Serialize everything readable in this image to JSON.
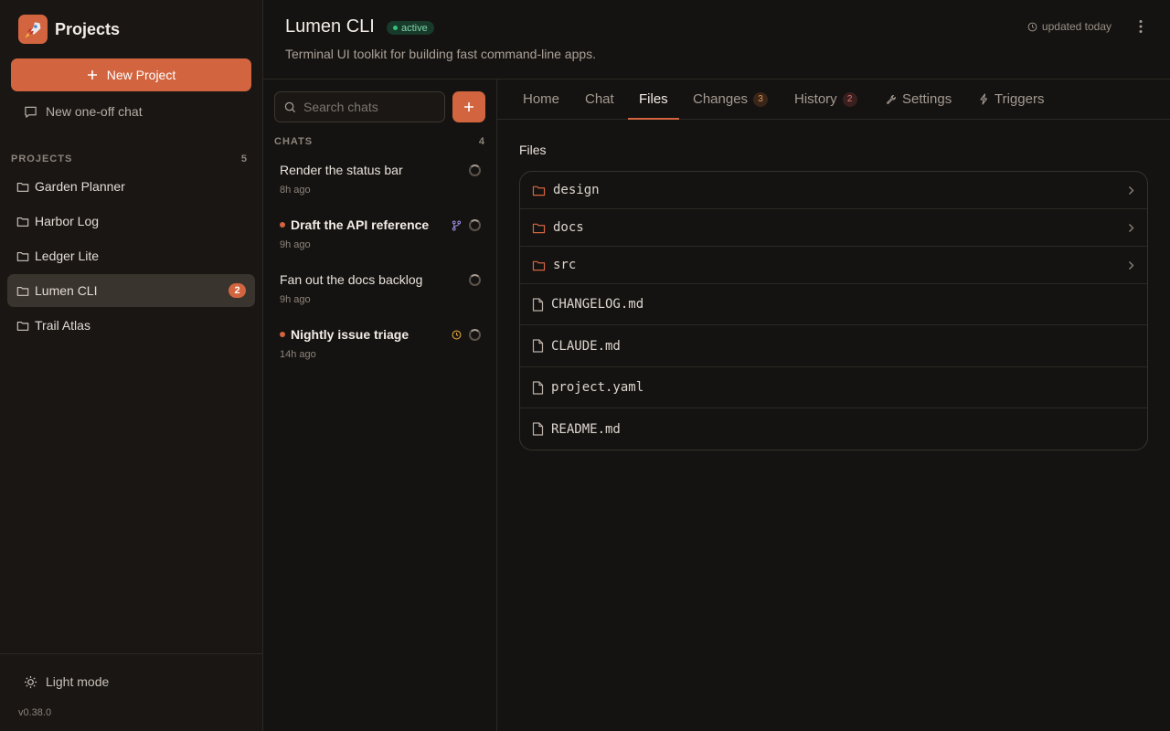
{
  "sidebar": {
    "brand_title": "Projects",
    "new_project_label": "New Project",
    "oneoff_label": "New one-off chat",
    "section_label": "PROJECTS",
    "section_count": "5",
    "projects": [
      {
        "name": "Garden Planner"
      },
      {
        "name": "Harbor Log"
      },
      {
        "name": "Ledger Lite"
      },
      {
        "name": "Lumen CLI",
        "badge": "2",
        "active": true
      },
      {
        "name": "Trail Atlas"
      }
    ],
    "light_mode_label": "Light mode",
    "version": "v0.38.0"
  },
  "header": {
    "title": "Lumen CLI",
    "status": "active",
    "description": "Terminal UI toolkit for building fast command-line apps.",
    "updated": "updated today"
  },
  "chats": {
    "search_placeholder": "Search chats",
    "section_label": "CHATS",
    "count": "4",
    "items": [
      {
        "title": "Render the status bar",
        "time": "8h ago"
      },
      {
        "title": "Draft the API reference",
        "time": "9h ago"
      },
      {
        "title": "Fan out the docs backlog",
        "time": "9h ago"
      },
      {
        "title": "Nightly issue triage",
        "time": "14h ago"
      }
    ]
  },
  "tabs": [
    {
      "label": "Home"
    },
    {
      "label": "Chat"
    },
    {
      "label": "Files"
    },
    {
      "label": "Changes",
      "count": "3"
    },
    {
      "label": "History",
      "count": "2"
    },
    {
      "label": "Settings"
    },
    {
      "label": "Triggers"
    }
  ],
  "files": {
    "title": "Files",
    "entries": [
      {
        "name": "design",
        "type": "folder"
      },
      {
        "name": "docs",
        "type": "folder"
      },
      {
        "name": "src",
        "type": "folder"
      },
      {
        "name": "CHANGELOG.md",
        "type": "file"
      },
      {
        "name": "CLAUDE.md",
        "type": "file"
      },
      {
        "name": "project.yaml",
        "type": "file"
      },
      {
        "name": "README.md",
        "type": "file"
      }
    ]
  },
  "colors": {
    "accent": "#d2653f",
    "background": "#151311",
    "status_green": "#36c078"
  }
}
